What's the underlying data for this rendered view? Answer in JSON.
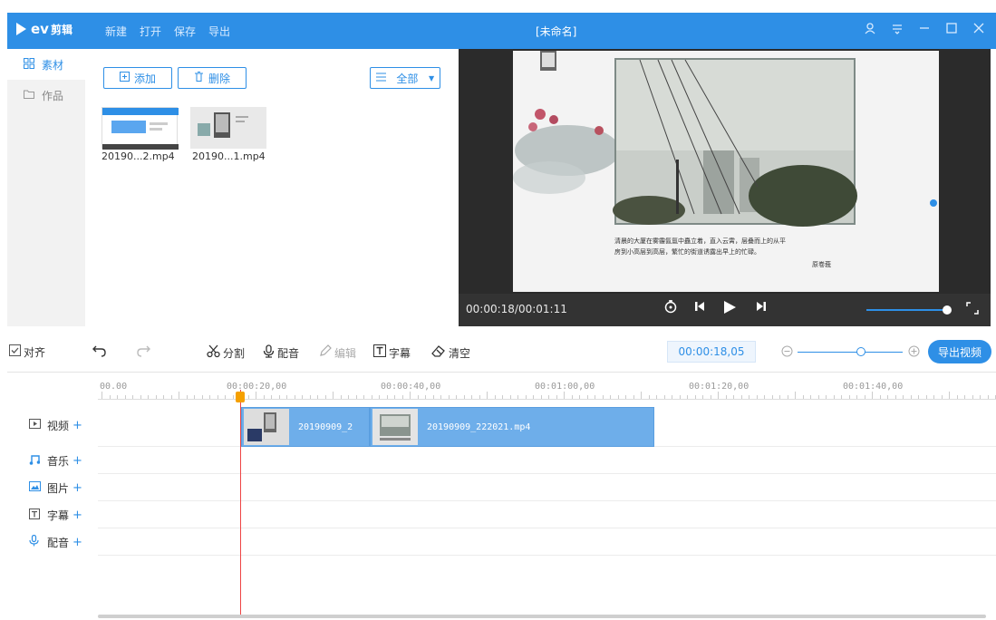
{
  "app": {
    "logo_text": "ev",
    "logo_sub": "剪辑",
    "menu": [
      "新建",
      "打开",
      "保存",
      "导出"
    ],
    "window_title": "[未命名]",
    "win_buttons": [
      "A",
      "≡",
      "—",
      "☐",
      "✕"
    ]
  },
  "sidebar": {
    "items": [
      {
        "icon": "grid-icon",
        "label": "素材",
        "active": true
      },
      {
        "icon": "folder-icon",
        "label": "作品",
        "active": false
      }
    ]
  },
  "material": {
    "add_label": "添加",
    "delete_label": "删除",
    "filter_label": "全部",
    "files": [
      {
        "name": "20190...2.mp4"
      },
      {
        "name": "20190...1.mp4"
      }
    ]
  },
  "preview": {
    "time": "00:00:18/00:01:11",
    "caption_line1": "清晨的大厦在雾霾氤氲中矗立着，直入云霄，层叠而上的从平",
    "caption_line2": "房到小高层到高层，繁忙的街道诱露出早上的忙碌。",
    "caption_author": "原卷莪",
    "volume": 0.9
  },
  "toolbar": {
    "align_label": "对齐",
    "split_label": "分割",
    "dub_label": "配音",
    "edit_label": "编辑",
    "subtitle_label": "字幕",
    "clear_label": "清空",
    "current_time": "00:00:18,05",
    "export_label": "导出视频"
  },
  "timeline": {
    "ruler": [
      "00.00",
      "00:00:20,00",
      "00:00:40,00",
      "00:01:00,00",
      "00:01:20,00",
      "00:01:40,00"
    ],
    "tracks": [
      {
        "icon": "video-icon",
        "label": "视频"
      },
      {
        "icon": "music-icon",
        "label": "音乐"
      },
      {
        "icon": "image-icon",
        "label": "图片"
      },
      {
        "icon": "subtitle-icon",
        "label": "字幕"
      },
      {
        "icon": "mic-icon",
        "label": "配音"
      }
    ],
    "clips": [
      {
        "name": "20190909_2"
      },
      {
        "name": "20190909_222021.mp4"
      }
    ]
  }
}
